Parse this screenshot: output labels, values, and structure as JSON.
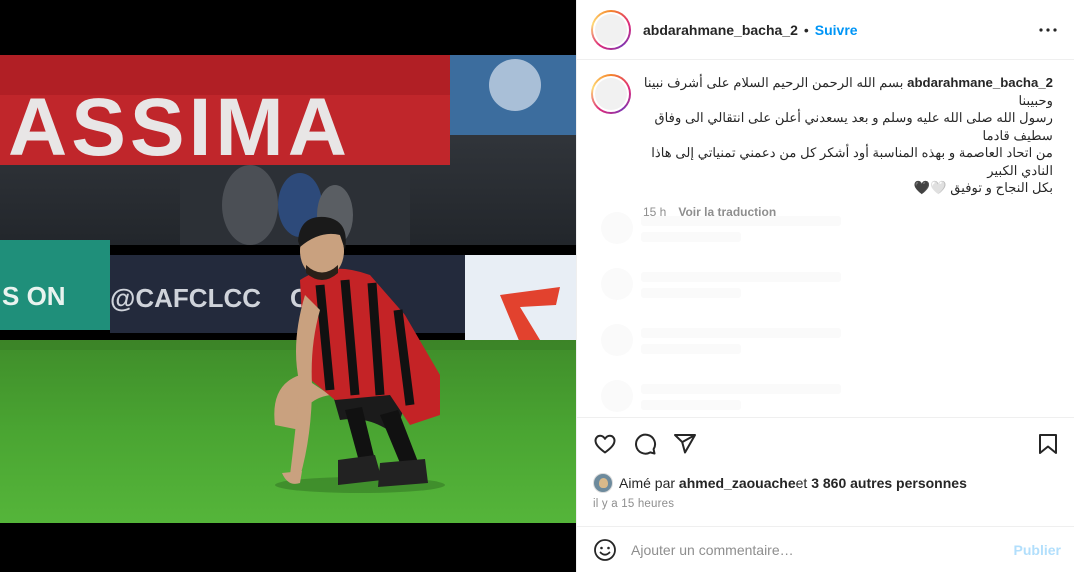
{
  "post": {
    "username": "abdarahmane_bacha_2",
    "separator": "•",
    "follow_label": "Suivre",
    "more_icon": "more-horizontal-icon",
    "photo_alt_banner": "ASSIMA",
    "photo_board_1": "S ON",
    "photo_board_2": "@CAFCLCC",
    "photo_board_3": "CLCC"
  },
  "caption": {
    "username": "abdarahmane_bacha_2",
    "line1": "بسم الله الرحمن الرحيم السلام على أشرف نبينا وحبيبنا",
    "line2": "رسول الله صلى الله عليه وسلم و بعد يسعدني أعلن على انتقالي الى وفاق سطيف قادما",
    "line3": "من اتحاد العاصمة و بهذه المناسبة أود أشكر كل من دعمني تمنياتي إلى هاذا النادي الكبير",
    "line4": "بكل النجاح و توفيق 🤍🖤",
    "age": "15 h",
    "translate_label": "Voir la traduction"
  },
  "actions": {
    "like_icon": "heart-icon",
    "comment_icon": "comment-icon",
    "share_icon": "share-icon",
    "save_icon": "bookmark-icon"
  },
  "likes": {
    "prefix": "Aimé par ",
    "liker": "ahmed_zaouache",
    "middle": " et ",
    "others": "3 860 autres personnes"
  },
  "timestamp": "il y a 15 heures",
  "comment_box": {
    "emoji_icon": "emoji-icon",
    "placeholder": "Ajouter un commentaire…",
    "publish_label": "Publier"
  },
  "colors": {
    "accent_blue": "#0095f6",
    "publish_disabled": "#b2dffc",
    "muted_text": "#8e8e8e",
    "border": "#efefef"
  }
}
